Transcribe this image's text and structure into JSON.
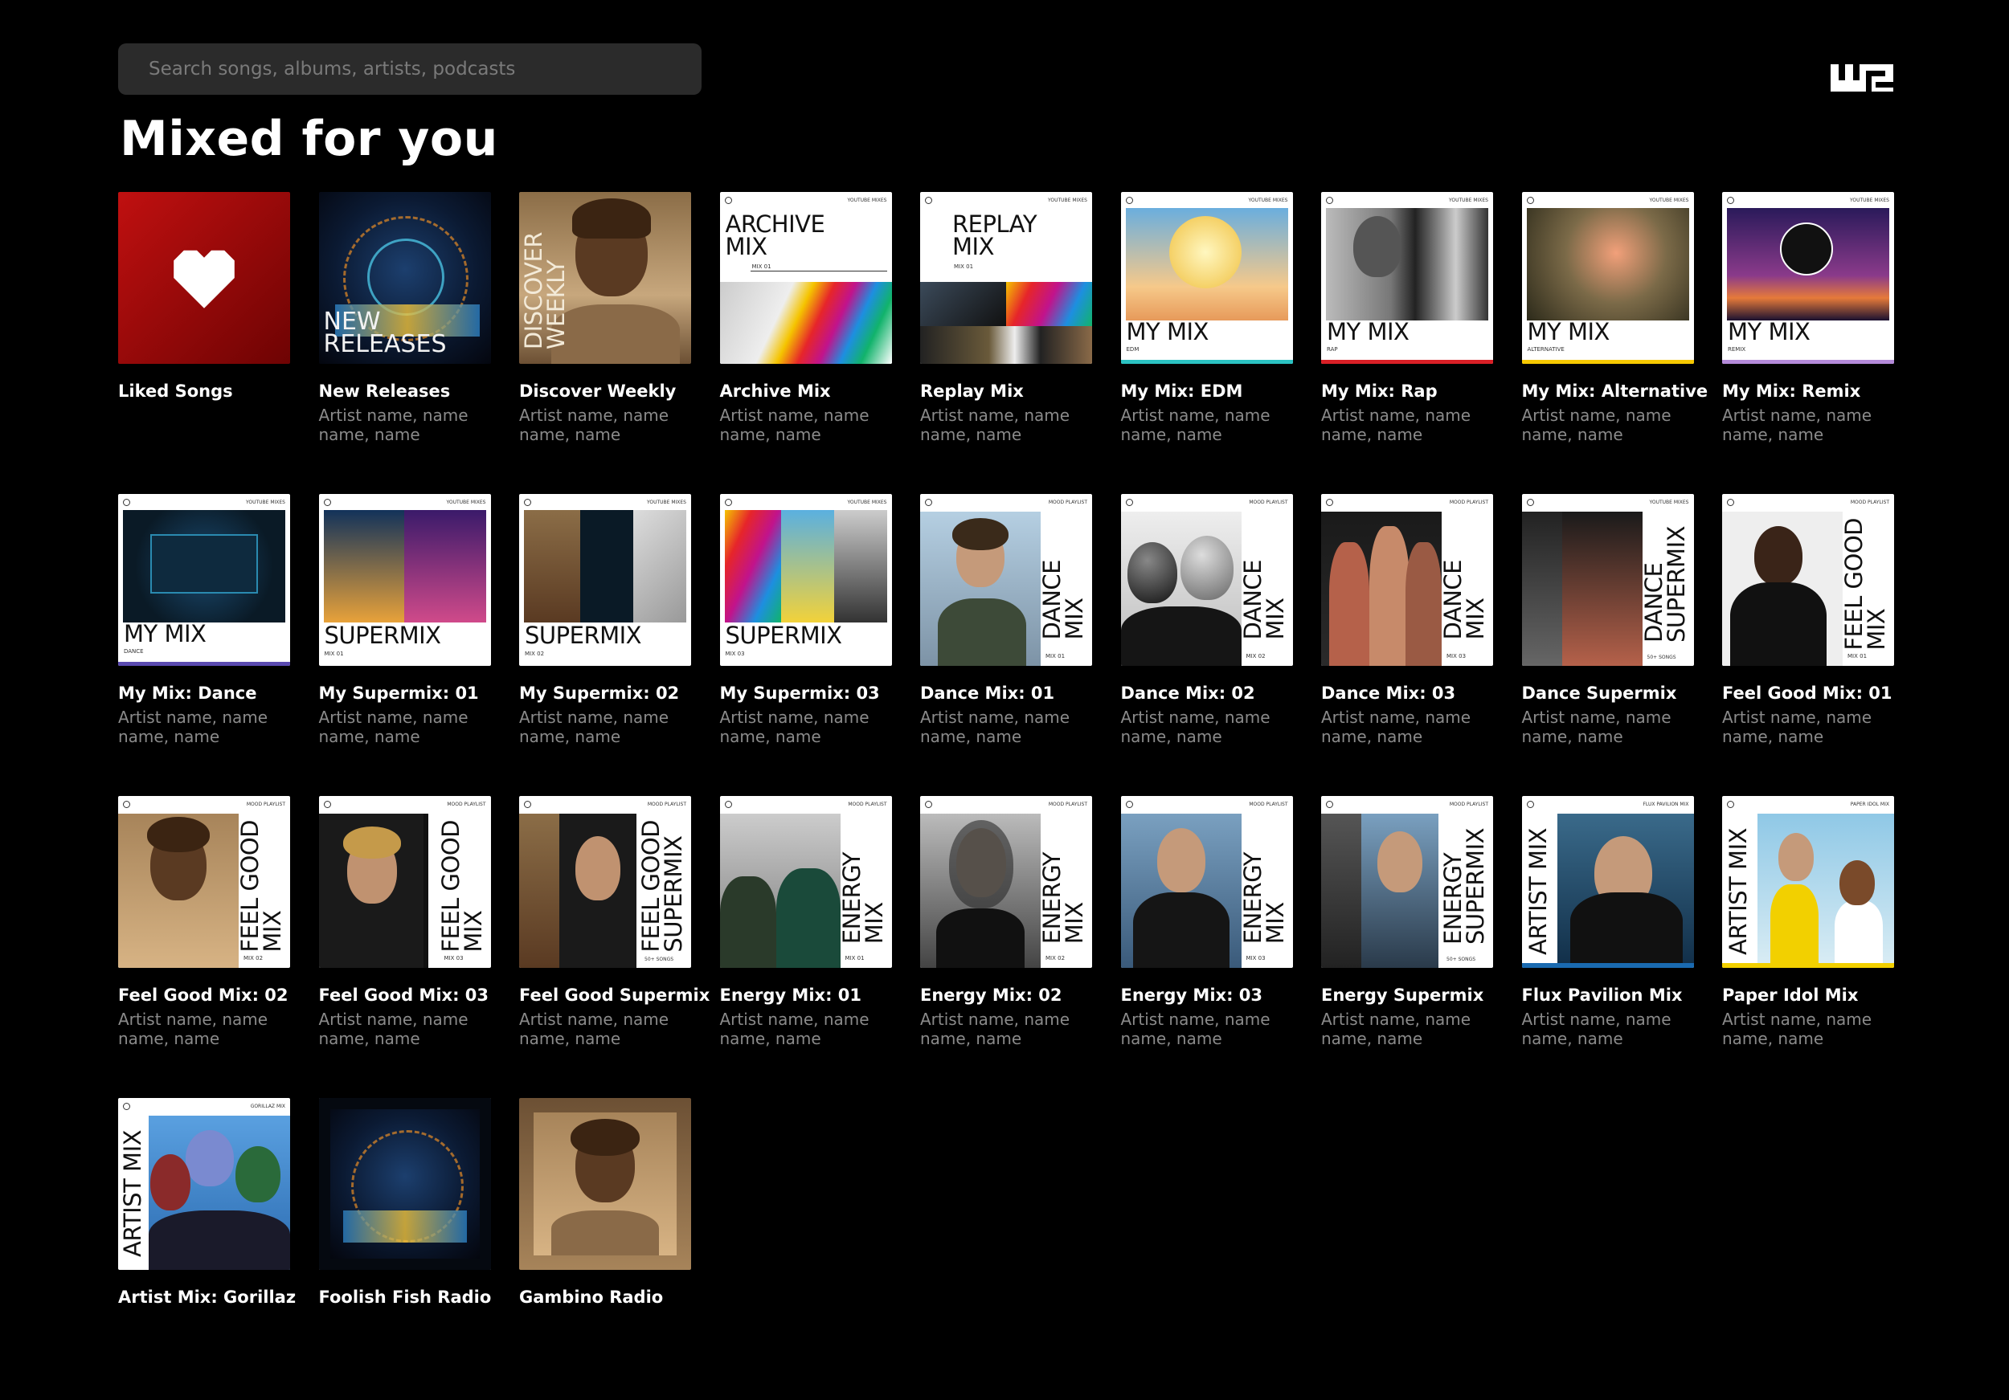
{
  "search": {
    "placeholder": "Search songs, albums, artists, podcasts"
  },
  "page_title": "Mixed for you",
  "subtitle_default": "Artist name, name name, name",
  "cards": [
    {
      "title": "Liked Songs",
      "subtitle": ""
    },
    {
      "title": "New Releases",
      "subtitle": "Artist name, name name, name",
      "cover": "NEW\nRELEASES"
    },
    {
      "title": "Discover Weekly",
      "subtitle": "Artist name, name name, name",
      "cover": "DISCOVER\nWEEKLY"
    },
    {
      "title": "Archive Mix",
      "subtitle": "Artist name, name name, name",
      "cover": "ARCHIVE\nMIX",
      "tag": "MIX 01"
    },
    {
      "title": "Replay Mix",
      "subtitle": "Artist name, name name, name",
      "cover": "REPLAY\nMIX",
      "tag": "MIX 01"
    },
    {
      "title": "My Mix: EDM",
      "subtitle": "Artist name, name name, name",
      "cover": "MY MIX",
      "tag": "EDM"
    },
    {
      "title": "My Mix: Rap",
      "subtitle": "Artist name, name name, name",
      "cover": "MY MIX",
      "tag": "RAP"
    },
    {
      "title": "My Mix: Alternative",
      "subtitle": "Artist name, name name, name",
      "cover": "MY MIX",
      "tag": "ALTERNATIVE"
    },
    {
      "title": "My Mix: Remix",
      "subtitle": "Artist name, name name, name",
      "cover": "MY MIX",
      "tag": "REMIX"
    },
    {
      "title": "My Mix: Dance",
      "subtitle": "Artist name, name name, name",
      "cover": "MY MIX",
      "tag": "DANCE"
    },
    {
      "title": "My Supermix: 01",
      "subtitle": "Artist name, name name, name",
      "cover": "SUPERMIX",
      "tag": "MIX 01"
    },
    {
      "title": "My Supermix: 02",
      "subtitle": "Artist name, name name, name",
      "cover": "SUPERMIX",
      "tag": "MIX 02"
    },
    {
      "title": "My Supermix: 03",
      "subtitle": "Artist name, name name, name",
      "cover": "SUPERMIX",
      "tag": "MIX 03"
    },
    {
      "title": "Dance Mix: 01",
      "subtitle": "Artist name, name name, name",
      "cover": "DANCE\nMIX",
      "tag": "MIX 01"
    },
    {
      "title": "Dance Mix: 02",
      "subtitle": "Artist name, name name, name",
      "cover": "DANCE\nMIX",
      "tag": "MIX 02"
    },
    {
      "title": "Dance Mix: 03",
      "subtitle": "Artist name, name name, name",
      "cover": "DANCE\nMIX",
      "tag": "MIX 03"
    },
    {
      "title": "Dance Supermix",
      "subtitle": "Artist name, name name, name",
      "cover": "DANCE\nSUPERMIX",
      "tag": "50+ SONGS"
    },
    {
      "title": "Feel Good Mix: 01",
      "subtitle": "Artist name, name name, name",
      "cover": "FEEL GOOD\nMIX",
      "tag": "MIX 01"
    },
    {
      "title": "Feel Good Mix: 02",
      "subtitle": "Artist name, name name, name",
      "cover": "FEEL GOOD\nMIX",
      "tag": "MIX 02"
    },
    {
      "title": "Feel Good Mix: 03",
      "subtitle": "Artist name, name name, name",
      "cover": "FEEL GOOD\nMIX",
      "tag": "MIX 03"
    },
    {
      "title": "Feel Good Supermix",
      "subtitle": "Artist name, name name, name",
      "cover": "FEEL GOOD\nSUPERMIX",
      "tag": "50+ SONGS"
    },
    {
      "title": "Energy Mix: 01",
      "subtitle": "Artist name, name name, name",
      "cover": "ENERGY\nMIX",
      "tag": "MIX 01"
    },
    {
      "title": "Energy Mix: 02",
      "subtitle": "Artist name, name name, name",
      "cover": "ENERGY\nMIX",
      "tag": "MIX 02"
    },
    {
      "title": "Energy Mix: 03",
      "subtitle": "Artist name, name name, name",
      "cover": "ENERGY\nMIX",
      "tag": "MIX 03"
    },
    {
      "title": "Energy Supermix",
      "subtitle": "Artist name, name name, name",
      "cover": "ENERGY\nSUPERMIX",
      "tag": "50+ SONGS"
    },
    {
      "title": "Flux Pavilion Mix",
      "subtitle": "Artist name, name name, name",
      "cover": "ARTIST MIX"
    },
    {
      "title": "Paper Idol Mix",
      "subtitle": "Artist name, name name, name",
      "cover": "ARTIST MIX"
    },
    {
      "title": "Artist Mix: Gorillaz",
      "subtitle": "",
      "cover": "ARTIST MIX"
    },
    {
      "title": "Foolish Fish Radio",
      "subtitle": ""
    },
    {
      "title": "Gambino Radio",
      "subtitle": ""
    }
  ],
  "colors": {
    "bg": "#000000",
    "search_bg": "#2b2b2b",
    "subtitle": "#8a8a8a",
    "liked_red": "#b00c0c"
  }
}
